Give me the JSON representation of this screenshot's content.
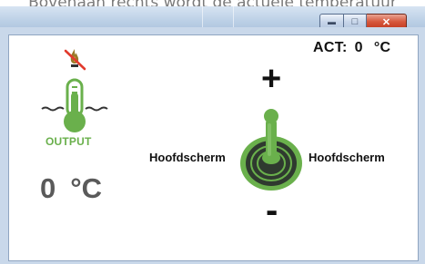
{
  "caption": "Bovenaan rechts wordt de actuele temperatuur",
  "window": {
    "minimize_glyph": "▬",
    "maximize_glyph": "□",
    "close_glyph": "✕"
  },
  "status": {
    "act_label": "ACT:",
    "act_value": "0",
    "act_unit": "°C"
  },
  "output": {
    "label": "OUTPUT",
    "value": "0",
    "unit": "°C",
    "icons": [
      "no-flame-icon",
      "thermometer-icon"
    ]
  },
  "control": {
    "plus": "+",
    "minus": "-",
    "left_label": "Hoofdscherm",
    "right_label": "Hoofdscherm",
    "icon": "joystick-icon"
  },
  "colors": {
    "accent_green": "#6ab04c",
    "joystick_dark": "#2f3a2f",
    "forbidden_red": "#e23b2e"
  }
}
